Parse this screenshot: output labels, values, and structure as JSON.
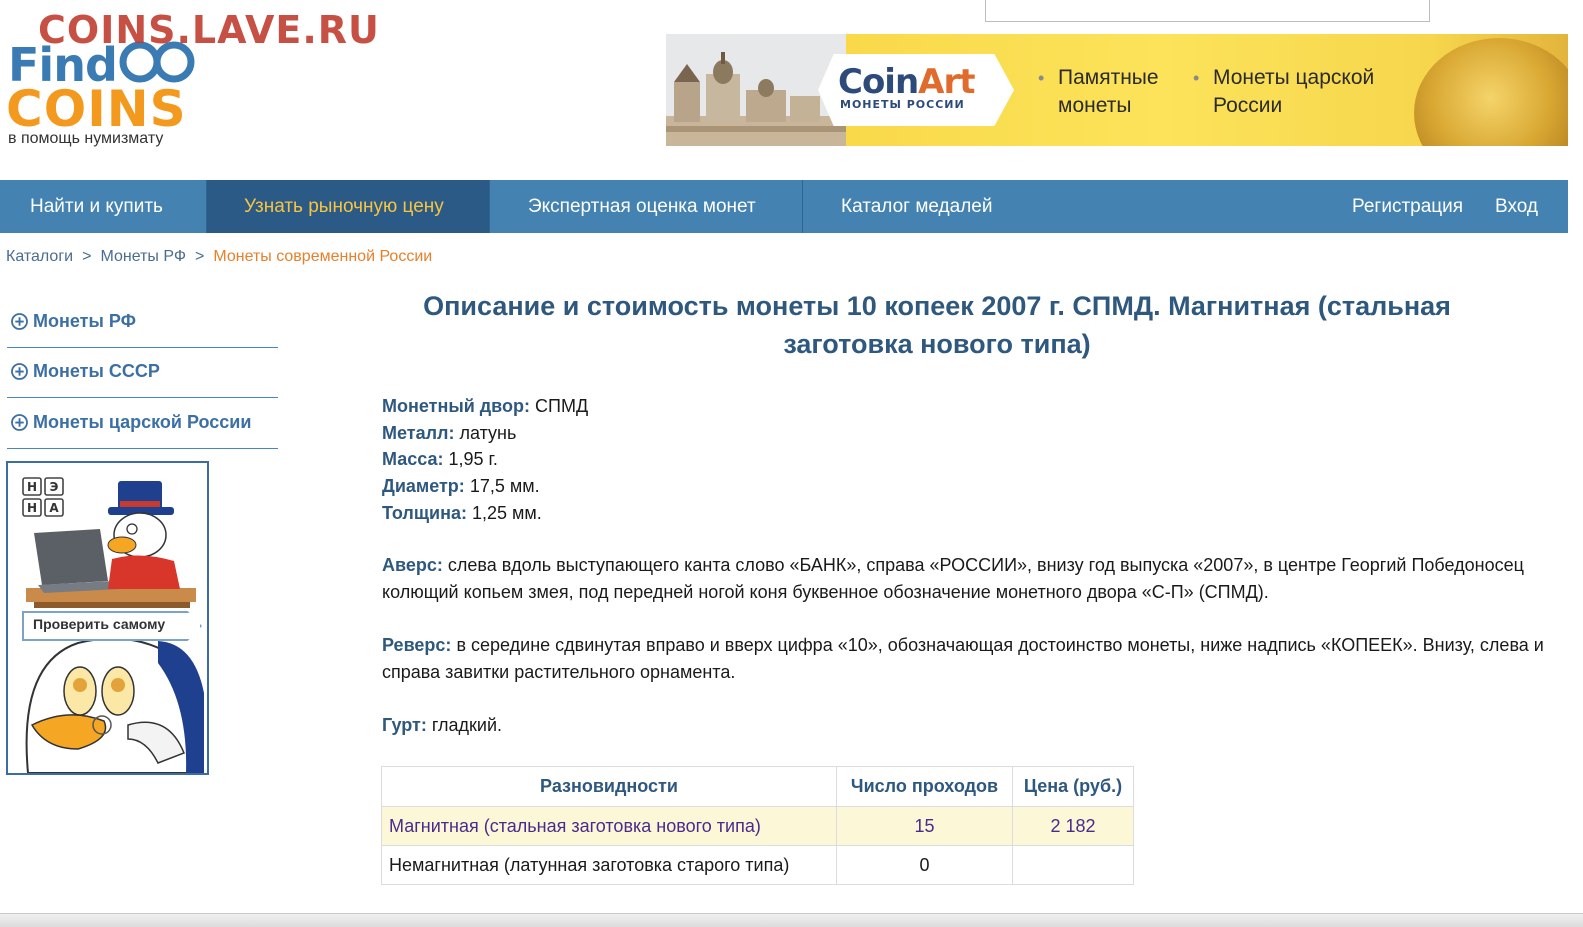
{
  "watermark": "COINS.LAVE.RU",
  "logo": {
    "find": "Find",
    "coins": "COINS",
    "tagline": "в помощь нумизмату"
  },
  "banner": {
    "brand_a": "Coin",
    "brand_b": "Art",
    "brand_sub": "МОНЕТЫ РОССИИ",
    "item1": "Памятные монеты",
    "item2": "Монеты царской России"
  },
  "nav": {
    "find_buy": "Найти и купить",
    "market_price": "Узнать рыночную цену",
    "expert": "Экспертная оценка монет",
    "medals": "Каталог медалей",
    "register": "Регистрация",
    "login": "Вход"
  },
  "breadcrumb": {
    "catalogs": "Каталоги",
    "sep": ">",
    "coins_rf": "Монеты РФ",
    "current": "Монеты современной России"
  },
  "sidebar": {
    "items": [
      "Монеты РФ",
      "Монеты СССР",
      "Монеты царской России"
    ],
    "promo_keys": [
      "Н",
      "Э",
      "Н",
      "А"
    ],
    "promo_label": "Проверить самому"
  },
  "main": {
    "title": "Описание и стоимость монеты 10 копеек 2007 г. СПМД. Магнитная (стальная заготовка нового типа)",
    "specs": [
      {
        "key": "Монетный двор:",
        "value": "СПМД"
      },
      {
        "key": "Металл:",
        "value": "латунь"
      },
      {
        "key": "Масса:",
        "value": "1,95 г."
      },
      {
        "key": "Диаметр:",
        "value": "17,5 мм."
      },
      {
        "key": "Толщина:",
        "value": "1,25 мм."
      }
    ],
    "obverse_key": "Аверс:",
    "obverse_text": "слева вдоль выступающего канта слово «БАНК», справа «РОССИИ», внизу год выпуска «2007», в центре Георгий Победоносец колющий копьем змея, под передней ногой коня буквенное обозначение монетного двора «С-П» (СПМД).",
    "reverse_key": "Реверс:",
    "reverse_text": "в середине сдвинутая вправо и вверх цифра «10», обозначающая достоинство монеты, ниже надпись «КОПЕЕК». Внизу, слева и справа завитки растительного орнамента.",
    "edge_key": "Гурт:",
    "edge_text": "гладкий."
  },
  "table": {
    "headers": [
      "Разновидности",
      "Число проходов",
      "Цена (руб.)"
    ],
    "rows": [
      {
        "variant": "Магнитная (стальная заготовка нового типа)",
        "passes": "15",
        "price": "2 182"
      },
      {
        "variant": "Немагнитная (латунная заготовка старого типа)",
        "passes": "0",
        "price": ""
      }
    ]
  },
  "colors": {
    "nav_bg": "#4382b1",
    "nav_active_bg": "#2c5a86",
    "nav_active_text": "#f6c440",
    "heading": "#2f587f",
    "breadcrumb_current": "#e8802b",
    "watermark": "#c0392b",
    "highlight_row": "#fcf8d7"
  }
}
